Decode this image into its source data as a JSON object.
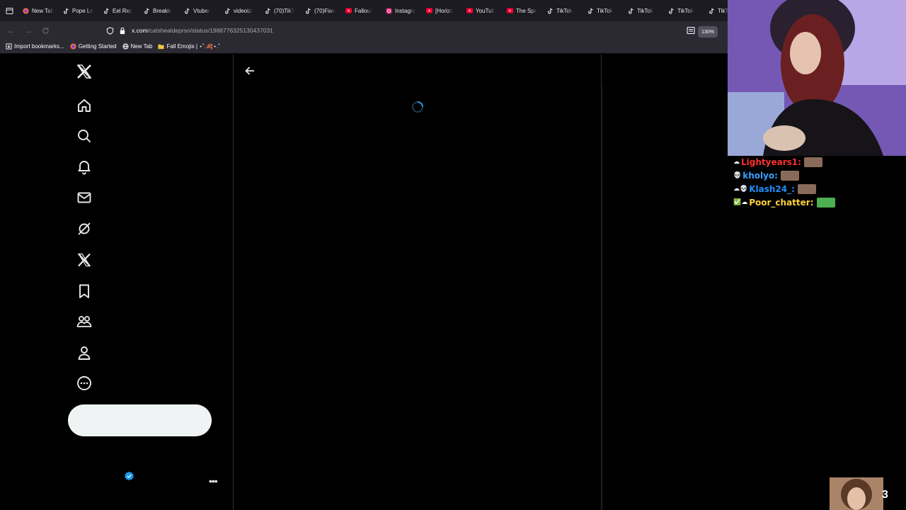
{
  "browser": {
    "tabs": [
      {
        "label": "New Tab",
        "icon": "firefox-icon"
      },
      {
        "label": "Pope Le",
        "icon": "tiktok-icon"
      },
      {
        "label": "Eel Rep",
        "icon": "tiktok-icon"
      },
      {
        "label": "Breakin",
        "icon": "tiktok-icon"
      },
      {
        "label": "Vtuber",
        "icon": "tiktok-icon"
      },
      {
        "label": "videoizi",
        "icon": "tiktok-icon"
      },
      {
        "label": "(70)TikT",
        "icon": "tiktok-icon"
      },
      {
        "label": "(70)Fian",
        "icon": "tiktok-icon"
      },
      {
        "label": "Fallout",
        "icon": "youtube-icon"
      },
      {
        "label": "Instagra",
        "icon": "instagram-icon"
      },
      {
        "label": "[Horizo",
        "icon": "youtube-icon"
      },
      {
        "label": "YouTub",
        "icon": "youtube-icon"
      },
      {
        "label": "The Spc",
        "icon": "youtube-icon"
      },
      {
        "label": "TikTok",
        "icon": "tiktok-icon"
      },
      {
        "label": "TikTok",
        "icon": "tiktok-icon"
      },
      {
        "label": "TikTok",
        "icon": "tiktok-icon"
      },
      {
        "label": "TikTok",
        "icon": "tiktok-icon"
      },
      {
        "label": "TikT",
        "icon": "tiktok-icon"
      }
    ],
    "url_host": "x.com",
    "url_path": "/catshealdeprsn/status/1988776325130437031",
    "zoom": "130%",
    "bookmarks": [
      {
        "label": "Import bookmarks...",
        "icon": "import-icon"
      },
      {
        "label": "Getting Started",
        "icon": "firefox-icon"
      },
      {
        "label": "New Tab",
        "icon": "globe-icon"
      },
      {
        "label": "Fall Emojis | ⋆˚.🍂⋆.˚",
        "icon": "folder-icon"
      }
    ]
  },
  "x_nav": [
    {
      "name": "x-logo-icon"
    },
    {
      "name": "home-icon"
    },
    {
      "name": "search-icon"
    },
    {
      "name": "notifications-icon"
    },
    {
      "name": "messages-icon"
    },
    {
      "name": "grok-icon"
    },
    {
      "name": "premium-x-icon"
    },
    {
      "name": "bookmarks-icon"
    },
    {
      "name": "communities-icon"
    },
    {
      "name": "profile-icon"
    },
    {
      "name": "more-icon"
    }
  ],
  "chat": [
    {
      "badges": "☁",
      "user": "Lightyears1",
      "color": "#ff2e2e"
    },
    {
      "badges": "💀",
      "user": "kholyo",
      "color": "#3aa0ff"
    },
    {
      "badges": "☁💀",
      "user": "Klash24_",
      "color": "#1e90ff"
    },
    {
      "badges": "✅☁",
      "user": "Poor_chatter",
      "color": "#ffd23a"
    }
  ],
  "overlay": {
    "viewer_count": "3"
  },
  "colors": {
    "x_background": "#000000",
    "x_border": "#2f3336",
    "post_button": "#eff3f4",
    "verified": "#1d9bf0"
  }
}
